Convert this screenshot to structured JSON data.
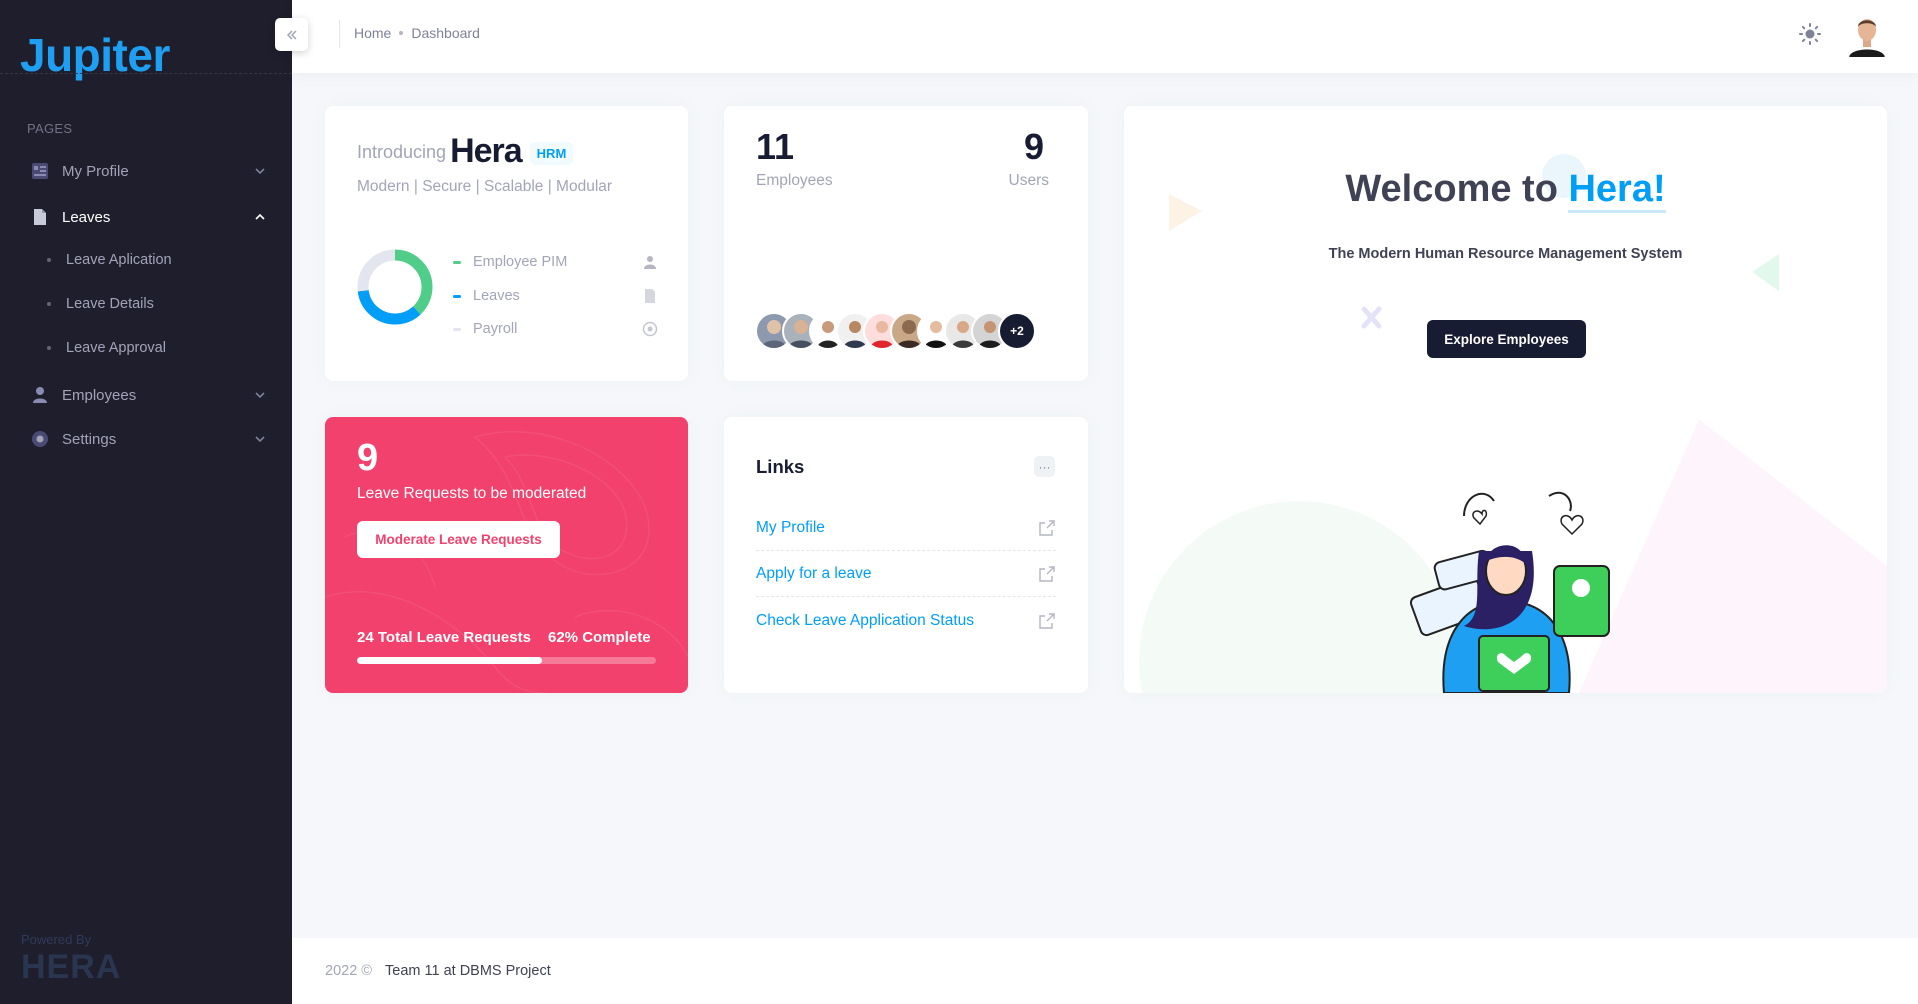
{
  "sidebar": {
    "logo": "Jupiter",
    "section_label": "PAGES",
    "items": [
      {
        "label": "My Profile"
      },
      {
        "label": "Leaves"
      },
      {
        "label": "Employees"
      },
      {
        "label": "Settings"
      }
    ],
    "leaves_sub": [
      {
        "label": "Leave Aplication"
      },
      {
        "label": "Leave Details"
      },
      {
        "label": "Leave Approval"
      }
    ],
    "powered_by": "Powered By",
    "powered_logo": "HERA"
  },
  "header": {
    "breadcrumb": [
      "Home",
      "Dashboard"
    ],
    "icons": [
      "collapse-icon",
      "sun-icon",
      "user-avatar"
    ]
  },
  "intro_card": {
    "prefix": "Introducing",
    "name": "Hera",
    "badge": "HRM",
    "tagline": "Modern | Secure | Scalable | Modular",
    "legend": [
      {
        "label": "Employee PIM",
        "color": "#50cd89",
        "icon": "user-icon"
      },
      {
        "label": "Leaves",
        "color": "#009ef7",
        "icon": "document-icon"
      },
      {
        "label": "Payroll",
        "color": "#e4e6ef",
        "icon": "target-icon"
      }
    ],
    "donut": [
      {
        "label": "Employee PIM",
        "color": "#50cd89",
        "share": 0.38
      },
      {
        "label": "Leaves",
        "color": "#009ef7",
        "share": 0.35
      },
      {
        "label": "Payroll",
        "color": "#e4e6ef",
        "share": 0.27
      }
    ]
  },
  "stats_card": {
    "employees_value": "11",
    "employees_label": "Employees",
    "users_value": "9",
    "users_label": "Users",
    "more_count": "+2"
  },
  "welcome_card": {
    "title_prefix": "Welcome to",
    "title_highlight": "Hera!",
    "subtitle": "The Modern Human Resource Management System",
    "button": "Explore Employees"
  },
  "leave_card": {
    "count": "9",
    "label": "Leave Requests to be moderated",
    "button": "Moderate Leave Requests",
    "total": "24 Total Leave Requests",
    "complete": "62% Complete",
    "progress": 0.62,
    "color": "#f1416c"
  },
  "links_card": {
    "title": "Links",
    "more": "···",
    "links": [
      {
        "label": "My Profile"
      },
      {
        "label": "Apply for a leave"
      },
      {
        "label": "Check Leave Application Status"
      }
    ]
  },
  "footer": {
    "year": "2022 ©",
    "team": "Team 11 at DBMS Project"
  }
}
